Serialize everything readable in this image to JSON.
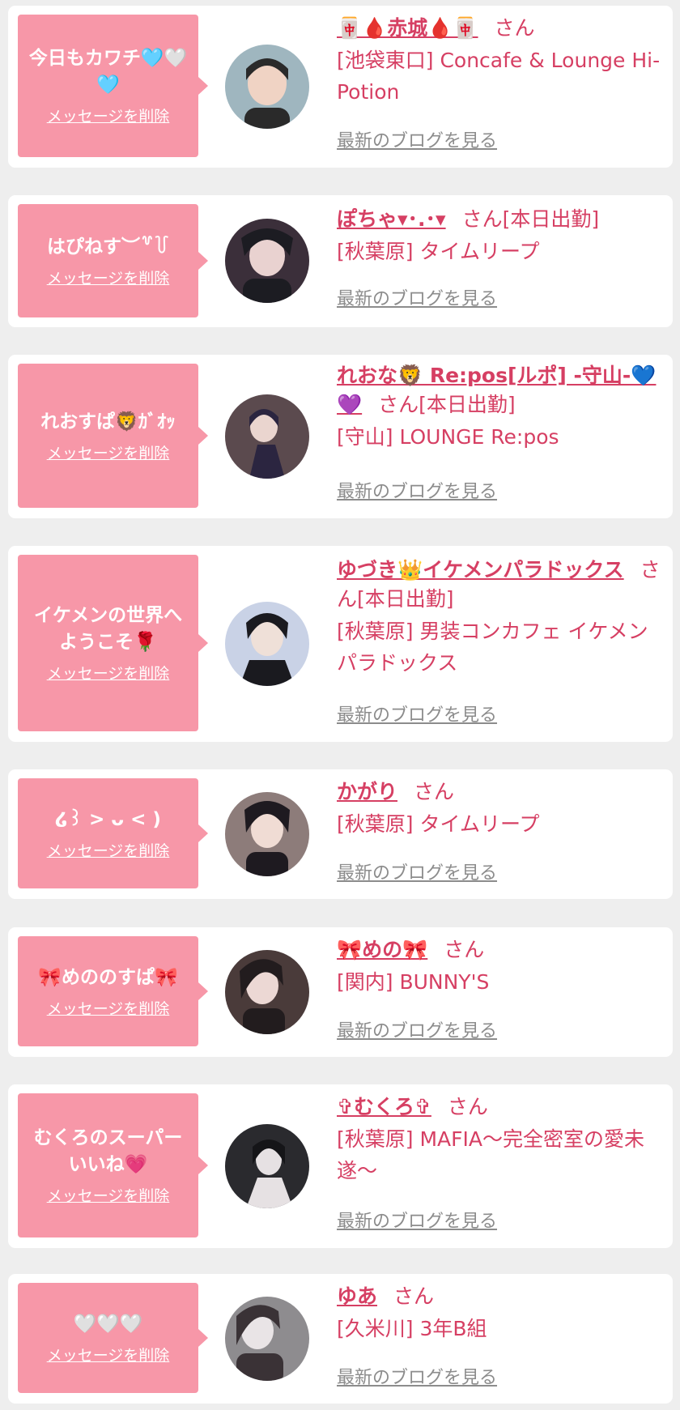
{
  "cards": [
    {
      "bubble_message": "今日もカワチ🩵🤍🩵",
      "delete_label": "メッセージを削除",
      "name": "🀄🩸赤城🩸🀄",
      "san": "さん",
      "status": "",
      "shop": "[池袋東口] Concafe & Lounge Hi-Potion",
      "blog_label": "最新のブログを見る",
      "avatar_colors": [
        "#9fb6bf",
        "#2a2a2a",
        "#f0d3c4"
      ]
    },
    {
      "bubble_message": "はぴねす︶꒷꒦",
      "delete_label": "メッセージを削除",
      "name": "ぽちゃ▾･.･▾",
      "san": "さん",
      "status": "[本日出勤]",
      "shop": "[秋葉原] タイムリープ",
      "blog_label": "最新のブログを見る",
      "avatar_colors": [
        "#3b2f3a",
        "#1c1c22",
        "#e9d2d0"
      ]
    },
    {
      "bubble_message": "れおすぱ🦁ｶﾞｵｯ",
      "delete_label": "メッセージを削除",
      "name": "れおな🦁 Re:pos[ルポ] -守山-💙💜",
      "san": "さん",
      "status": "[本日出勤]",
      "shop": "[守山] LOUNGE Re:pos",
      "blog_label": "最新のブログを見る",
      "avatar_colors": [
        "#5b4a4e",
        "#2b2540",
        "#ead5cf"
      ]
    },
    {
      "bubble_message": "イケメンの世界へようこそ🌹",
      "delete_label": "メッセージを削除",
      "name": "ゆづき👑イケメンパラドックス",
      "san": "さん",
      "status": "[本日出勤]",
      "shop": "[秋葉原] 男装コンカフェ イケメンパラドックス",
      "blog_label": "最新のブログを見る",
      "avatar_colors": [
        "#c9d2e6",
        "#1a1a1f",
        "#efe0d8"
      ]
    },
    {
      "bubble_message": "໒꒱ > ᴗ < )",
      "delete_label": "メッセージを削除",
      "name": "かがり",
      "san": "さん",
      "status": "",
      "shop": "[秋葉原] タイムリープ",
      "blog_label": "最新のブログを見る",
      "avatar_colors": [
        "#8d7c7a",
        "#1e1a20",
        "#f0dcd4"
      ]
    },
    {
      "bubble_message": "🎀めののすぱ🎀",
      "delete_label": "メッセージを削除",
      "name": "🎀めの🎀",
      "san": "さん",
      "status": "",
      "shop": "[関内] BUNNY'S",
      "blog_label": "最新のブログを見る",
      "avatar_colors": [
        "#4a3b3a",
        "#221c1e",
        "#ecd8d4"
      ]
    },
    {
      "bubble_message": "むくろのスーパーいいね💗",
      "delete_label": "メッセージを削除",
      "name": "✞むくろ✞",
      "san": "さん",
      "status": "",
      "shop": "[秋葉原] MAFIA〜完全密室の愛未遂〜",
      "blog_label": "最新のブログを見る",
      "avatar_colors": [
        "#2a2a2e",
        "#151518",
        "#e6e1e3"
      ]
    },
    {
      "bubble_message": "🤍🤍🤍",
      "delete_label": "メッセージを削除",
      "name": "ゆあ",
      "san": "さん",
      "status": "",
      "shop": "[久米川] 3年B組",
      "blog_label": "最新のブログを見る",
      "avatar_colors": [
        "#8e8c8f",
        "#3a3236",
        "#e9e4e6"
      ]
    }
  ]
}
